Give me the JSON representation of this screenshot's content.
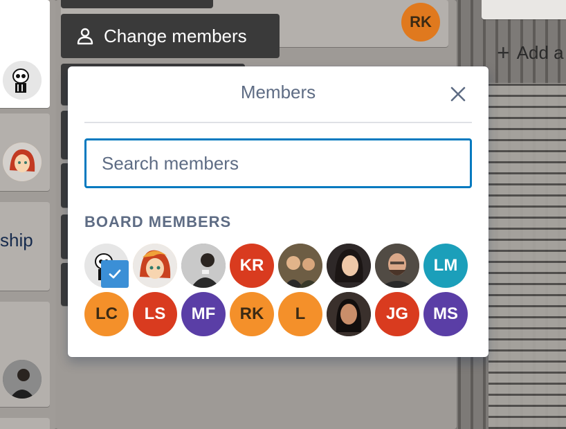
{
  "board": {
    "card_text_ship": "ship",
    "add_list_label": "Add a",
    "rk_badge": "RK"
  },
  "action": {
    "label": "Change members",
    "icon": "person-icon"
  },
  "popover": {
    "title": "Members",
    "close_icon": "close-icon",
    "search": {
      "placeholder": "Search members",
      "value": ""
    },
    "section_label": "BOARD MEMBERS",
    "members": [
      {
        "kind": "photo",
        "initials": "",
        "color": "#e8e8e8",
        "selected": true
      },
      {
        "kind": "photo",
        "initials": "",
        "color": "#f6d9b5",
        "selected": false
      },
      {
        "kind": "photo",
        "initials": "",
        "color": "#9e9e9e",
        "selected": false
      },
      {
        "kind": "initials",
        "initials": "KR",
        "color": "#d93b1f",
        "selected": false
      },
      {
        "kind": "photo",
        "initials": "",
        "color": "#7b6a4e",
        "selected": false
      },
      {
        "kind": "photo",
        "initials": "",
        "color": "#3b3030",
        "selected": false
      },
      {
        "kind": "photo",
        "initials": "",
        "color": "#5a534a",
        "selected": false
      },
      {
        "kind": "initials",
        "initials": "LM",
        "color": "#1b9fba",
        "selected": false
      },
      {
        "kind": "initials",
        "initials": "LC",
        "color": "#f4902a",
        "selected": false
      },
      {
        "kind": "initials",
        "initials": "LS",
        "color": "#d93b1f",
        "selected": false
      },
      {
        "kind": "initials",
        "initials": "MF",
        "color": "#5a3ea6",
        "selected": false
      },
      {
        "kind": "initials",
        "initials": "RK",
        "color": "#f4902a",
        "selected": false
      },
      {
        "kind": "initials",
        "initials": "L",
        "color": "#f4902a",
        "selected": false
      },
      {
        "kind": "photo",
        "initials": "",
        "color": "#2e2622",
        "selected": false
      },
      {
        "kind": "initials",
        "initials": "JG",
        "color": "#d93b1f",
        "selected": false
      },
      {
        "kind": "initials",
        "initials": "MS",
        "color": "#5a3ea6",
        "selected": false
      }
    ]
  }
}
